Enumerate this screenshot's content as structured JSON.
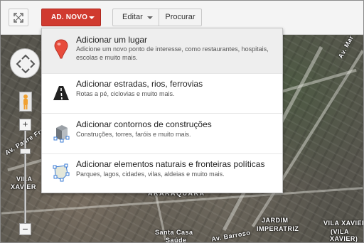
{
  "toolbar": {
    "fullscreen_icon": "expand-icon",
    "new_label": "AD. NOVO",
    "edit_label": "Editar",
    "search_label": "Procurar",
    "accent_color": "#d03a2f"
  },
  "menu": {
    "items": [
      {
        "title": "Adicionar um lugar",
        "description": "Adicione um novo ponto de interesse, como restaurantes, hospitais, escolas e muito mais.",
        "icon": "map-pin-icon"
      },
      {
        "title": "Adicionar estradas, rios, ferrovias",
        "description": "Rotas a pé, ciclovias e muito mais.",
        "icon": "road-icon"
      },
      {
        "title": "Adicionar contornos de construções",
        "description": "Construções, torres, faróis e muito mais.",
        "icon": "building-icon"
      },
      {
        "title": "Adicionar elementos naturais e fronteiras políticas",
        "description": "Parques, lagos, cidades, vilas, aldeias e muito mais.",
        "icon": "polygon-icon"
      }
    ]
  },
  "map": {
    "labels": [
      "Av. Padre Fra",
      "VILA",
      "XAVIER",
      "ARARAQUARA",
      "JARDIM",
      "IMPERATRIZ",
      "VILA XAVIER",
      "(VILA",
      "XAVIER)",
      "Santa Casa",
      "Saúde",
      "Av. Barroso",
      "Av. Mar"
    ],
    "controls": {
      "zoom_in": "+",
      "zoom_out": "−"
    }
  }
}
